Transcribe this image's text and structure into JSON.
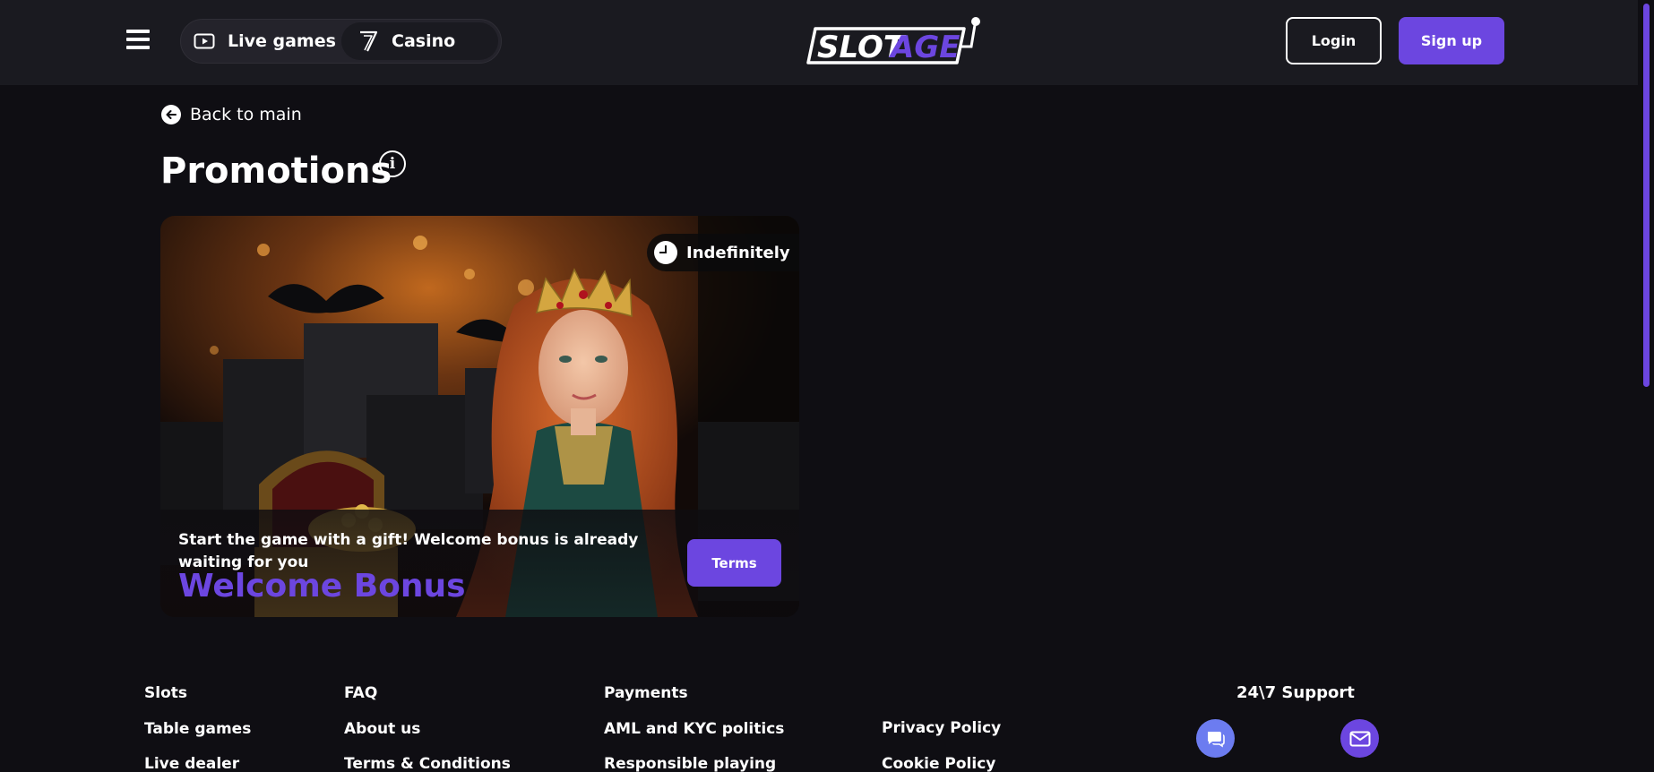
{
  "header": {
    "menu_icon": "hamburger-menu-icon",
    "modes": [
      {
        "label": "Live games",
        "icon": "play-video-icon"
      },
      {
        "label": "Casino",
        "icon": "seven-slot-icon"
      }
    ],
    "logo": {
      "part1": "SLOT",
      "part2": "AGE"
    },
    "login_label": "Login",
    "signup_label": "Sign up"
  },
  "back_link": {
    "label": "Back to main",
    "icon": "arrow-left-circle-icon"
  },
  "page_title": "Promotions",
  "info_icon_glyph": "i",
  "promo": {
    "duration": "Indefinitely",
    "description": "Start the game with a gift! Welcome bonus is already waiting for you",
    "name": "Welcome Bonus",
    "terms_label": "Terms"
  },
  "footer": {
    "col1": [
      "Slots",
      "Table games",
      "Live dealer"
    ],
    "col2": [
      "FAQ",
      "About us",
      "Terms & Conditions"
    ],
    "col3": [
      "Payments",
      "AML and KYC politics",
      "Responsible playing"
    ],
    "col4": [
      "Privacy Policy",
      "Cookie Policy"
    ],
    "support_title": "24\\7 Support",
    "support_icons": [
      "chat-icon",
      "mail-icon"
    ]
  },
  "colors": {
    "accent": "#6c46e0",
    "header_bg": "#1a1a20",
    "page_bg": "#0f0e13"
  }
}
